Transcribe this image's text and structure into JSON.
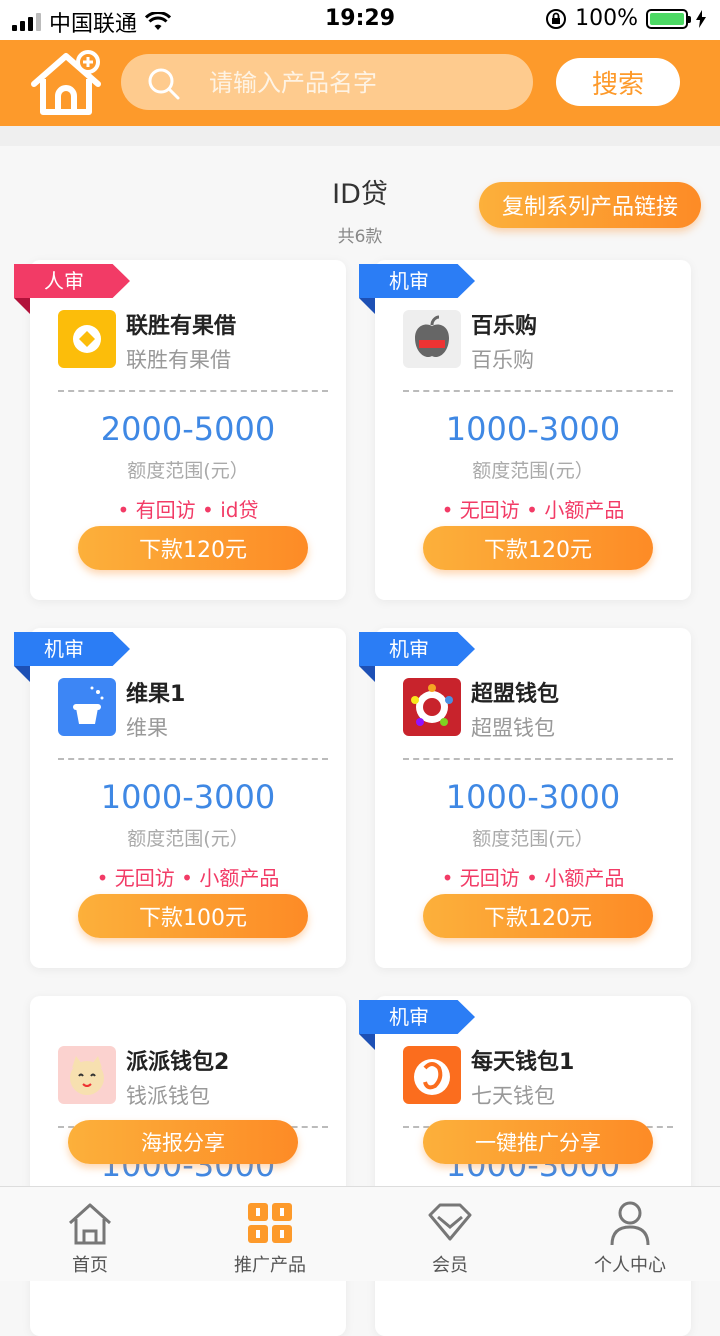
{
  "status_bar": {
    "carrier": "中国联通",
    "time": "19:29",
    "battery": "100%"
  },
  "header": {
    "search_placeholder": "请输入产品名字",
    "search_button": "搜索"
  },
  "section": {
    "title": "ID贷",
    "count": "共6款",
    "copy_button": "复制系列产品链接"
  },
  "cards": [
    {
      "tag": "人审",
      "name": "联胜有果借",
      "sub": "联胜有果借",
      "range": "2000-5000",
      "range_label": "额度范围(元）",
      "features": "• 有回访 • id贷",
      "button": "下款120元"
    },
    {
      "tag": "机审",
      "name": "百乐购",
      "sub": "百乐购",
      "range": "1000-3000",
      "range_label": "额度范围(元）",
      "features": "• 无回访 • 小额产品",
      "button": "下款120元"
    },
    {
      "tag": "机审",
      "name": "维果1",
      "sub": "维果",
      "range": "1000-3000",
      "range_label": "额度范围(元）",
      "features": "• 无回访 • 小额产品",
      "button": "下款100元"
    },
    {
      "tag": "机审",
      "name": "超盟钱包",
      "sub": "超盟钱包",
      "range": "1000-3000",
      "range_label": "额度范围(元）",
      "features": "• 无回访 • 小额产品",
      "button": "下款120元"
    },
    {
      "tag": "",
      "name": "派派钱包2",
      "sub": "钱派钱包",
      "range": "1000-3000"
    },
    {
      "tag": "机审",
      "name": "每天钱包1",
      "sub": "七天钱包",
      "range": "1000-3000"
    }
  ],
  "share": {
    "poster": "海报分享",
    "one_click": "一键推广分享"
  },
  "tabbar": {
    "home": "首页",
    "promote": "推广产品",
    "member": "会员",
    "profile": "个人中心"
  },
  "colors": {
    "brand_orange": "#fd9a2b",
    "tag_red": "#f23b66",
    "tag_blue": "#2b7df5",
    "range_blue": "#3f88e4"
  }
}
